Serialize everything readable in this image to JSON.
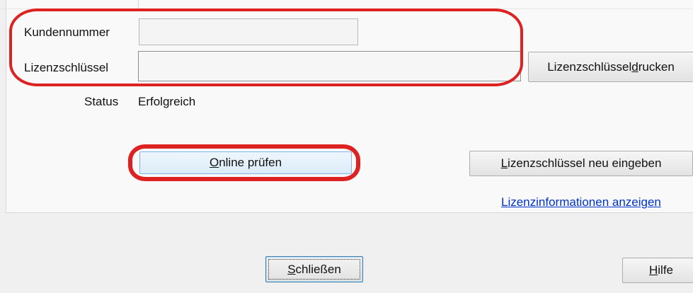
{
  "form": {
    "customer_number": {
      "label": "Kundennummer",
      "value": ""
    },
    "license_key": {
      "label": "Lizenzschlüssel",
      "value": ""
    },
    "status": {
      "label": "Status",
      "value": "Erfolgreich"
    }
  },
  "buttons": {
    "print_key": {
      "pre": "Lizenzschlüssel ",
      "underlined": "d",
      "post": "rucken"
    },
    "online_check": {
      "pre": "",
      "underlined": "O",
      "post": "nline prüfen"
    },
    "reenter_key": {
      "pre": "",
      "underlined": "L",
      "post": "izenzschlüssel neu eingeben"
    },
    "close": {
      "pre": "",
      "underlined": "S",
      "post": "chließen"
    },
    "help": {
      "pre": "",
      "underlined": "H",
      "post": "ilfe"
    }
  },
  "links": {
    "license_info": "Lizenzinformationen anzeigen"
  },
  "colors": {
    "highlight": "#dd2222",
    "link": "#0033cc",
    "focus_border": "#3c7fb1"
  }
}
